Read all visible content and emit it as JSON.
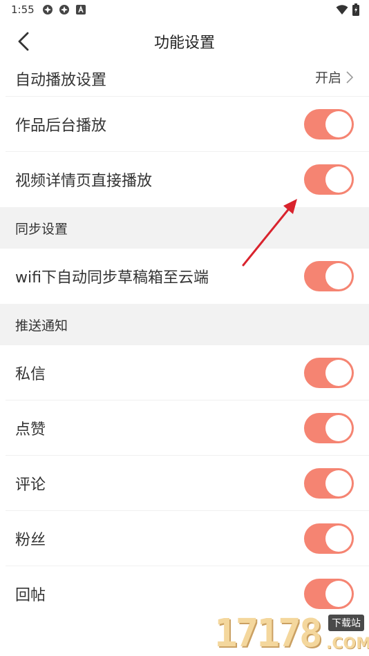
{
  "status_bar": {
    "time": "1:55"
  },
  "header": {
    "title": "功能设置"
  },
  "rows_top": [
    {
      "label": "自动播放设置",
      "value": "开启"
    },
    {
      "label": "作品后台播放",
      "toggle_on": true
    },
    {
      "label": "视频详情页直接播放",
      "toggle_on": true
    }
  ],
  "sections": {
    "sync": {
      "title": "同步设置",
      "rows": [
        {
          "label": "wifi下自动同步草稿箱至云端",
          "toggle_on": true
        }
      ]
    },
    "push": {
      "title": "推送通知",
      "rows": [
        {
          "label": "私信",
          "toggle_on": true
        },
        {
          "label": "点赞",
          "toggle_on": true
        },
        {
          "label": "评论",
          "toggle_on": true
        },
        {
          "label": "粉丝",
          "toggle_on": true
        },
        {
          "label": "回帖",
          "toggle_on": true
        }
      ]
    }
  },
  "watermark": {
    "digits": "17178",
    "tag": "下载站",
    "suffix": ".COM"
  },
  "colors": {
    "toggle_on": "#f58472",
    "section_bg": "#f2f2f2",
    "annotation_arrow": "#d9232d"
  }
}
